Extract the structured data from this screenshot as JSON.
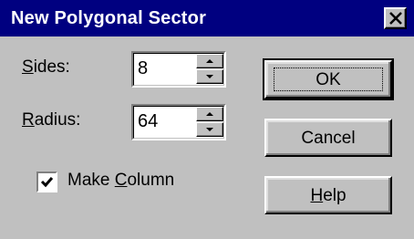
{
  "dialog": {
    "title": "New Polygonal Sector",
    "sides": {
      "label_mnemonic": "S",
      "label_rest": "ides:",
      "value": "8"
    },
    "radius": {
      "label_mnemonic": "R",
      "label_rest": "adius:",
      "value": "64"
    },
    "make_column": {
      "label_before": "Make ",
      "label_mnemonic": "C",
      "label_rest": "olumn",
      "checked": true
    },
    "buttons": {
      "ok": "OK",
      "cancel": "Cancel",
      "help_mnemonic": "H",
      "help_rest": "elp"
    }
  },
  "colors": {
    "titlebar": "#000080",
    "face": "#c0c0c0"
  },
  "icons": {
    "close": "close-icon",
    "spin_up": "arrow-up-icon",
    "spin_down": "arrow-down-icon",
    "check": "checkmark-icon"
  }
}
